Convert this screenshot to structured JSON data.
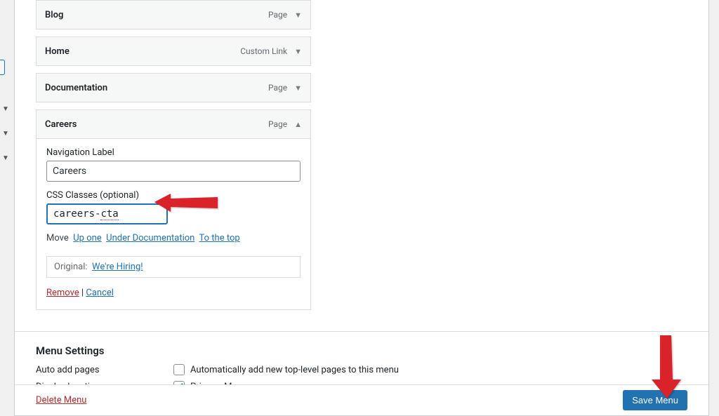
{
  "menu_items": [
    {
      "title": "Blog",
      "type": "Page",
      "expanded": false
    },
    {
      "title": "Home",
      "type": "Custom Link",
      "expanded": false
    },
    {
      "title": "Documentation",
      "type": "Page",
      "expanded": false
    },
    {
      "title": "Careers",
      "type": "Page",
      "expanded": true
    }
  ],
  "expanded_item": {
    "nav_label_field": "Navigation Label",
    "nav_label_value": "Careers",
    "css_field_label": "CSS Classes (optional)",
    "css_value_prefix": "careers-",
    "css_value_suffix": "cta",
    "move_label": "Move",
    "move_up": "Up one",
    "move_under": "Under Documentation",
    "move_top": "To the top",
    "original_label": "Original:",
    "original_link": "We're Hiring!",
    "remove_label": "Remove",
    "cancel_label": "Cancel",
    "divider": " | "
  },
  "menu_settings": {
    "heading": "Menu Settings",
    "auto_add_label": "Auto add pages",
    "auto_add_text": "Automatically add new top-level pages to this menu",
    "auto_add_checked": false,
    "display_loc_label": "Display location",
    "display_loc_text": "Primary Menu",
    "display_loc_checked": true
  },
  "footer": {
    "delete_label": "Delete Menu",
    "save_label": "Save Menu"
  }
}
